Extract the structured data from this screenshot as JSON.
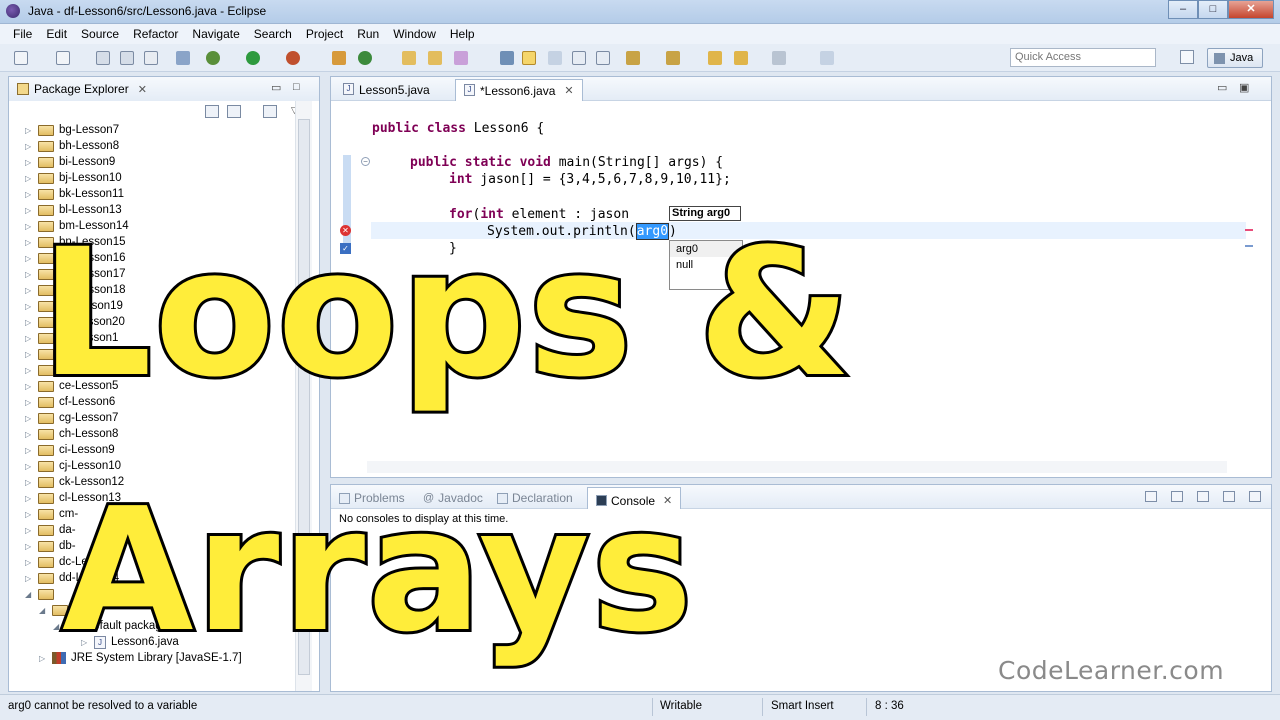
{
  "window": {
    "title": "Java - df-Lesson6/src/Lesson6.java - Eclipse",
    "minimize": "–",
    "maximize": "□",
    "close": "✕"
  },
  "menu": [
    "File",
    "Edit",
    "Source",
    "Refactor",
    "Navigate",
    "Search",
    "Project",
    "Run",
    "Window",
    "Help"
  ],
  "toolbar": {
    "quick_access_placeholder": "Quick Access",
    "perspective_label": "Java"
  },
  "package_explorer": {
    "title": "Package Explorer",
    "projects": [
      "bg-Lesson7",
      "bh-Lesson8",
      "bi-Lesson9",
      "bj-Lesson10",
      "bk-Lesson11",
      "bl-Lesson13",
      "bm-Lesson14",
      "bn-Lesson15",
      "bo-Lesson16",
      "bp-Lesson17",
      "bq-Lesson18",
      "br-Lesson19",
      "bs-Lesson20",
      "cd-Lesson1",
      "",
      "",
      "ce-Lesson5",
      "cf-Lesson6",
      "cg-Lesson7",
      "ch-Lesson8",
      "ci-Lesson9",
      "cj-Lesson10",
      "ck-Lesson12",
      "cl-Lesson13",
      "cm-",
      "da-",
      "db-",
      "dc-Lesson3",
      "dd-Lesson4",
      "",
      "",
      "(default package)",
      "Lesson6.java",
      "JRE System Library [JavaSE-1.7]"
    ]
  },
  "editor": {
    "tabs": [
      {
        "label": "Lesson5.java",
        "active": false
      },
      {
        "label": "*Lesson6.java",
        "active": true
      }
    ],
    "code": {
      "line1_kw": "public class",
      "line1_rest": " Lesson6 {",
      "line2_kw": "public static void",
      "line2_rest": " main(String[] args) {",
      "line3_kw": "int",
      "line3_rest": " jason[] = {3,4,5,6,7,8,9,10,11};",
      "line4_kw": "for",
      "line4_rest_a": "(",
      "line4_kw2": "int",
      "line4_rest_b": " element : jason",
      "line5_pre": "System.out.println(",
      "line5_sel": "arg0",
      "line5_post": ")",
      "line6": "}",
      "line7": "}"
    },
    "param_hint": "String arg0",
    "content_assist": [
      "arg0",
      "null"
    ]
  },
  "bottom_panel": {
    "tabs": [
      {
        "label": "Problems",
        "active": false
      },
      {
        "label": "Javadoc",
        "active": false
      },
      {
        "label": "Declaration",
        "active": false
      },
      {
        "label": "Console",
        "active": true
      }
    ],
    "message": "No consoles to display at this time."
  },
  "status": {
    "message": "arg0 cannot be resolved to a variable",
    "writable": "Writable",
    "insert_mode": "Smart Insert",
    "position": "8 : 36"
  },
  "overlay": {
    "line1": "Loops &",
    "line2": "Arrays"
  },
  "watermark": "CodeLearner.com"
}
